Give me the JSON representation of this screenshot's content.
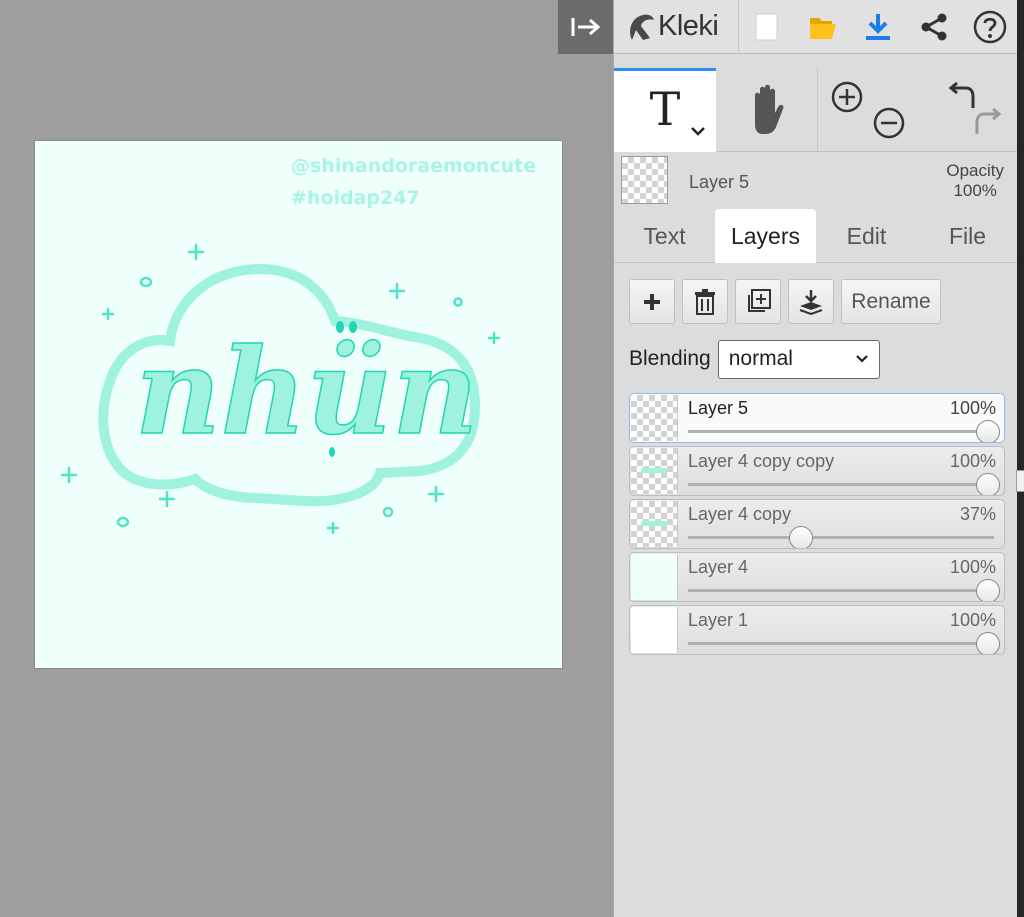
{
  "app": {
    "name": "Kleki",
    "accent": "#2b8ef5"
  },
  "toolbar": {
    "icons": [
      "kleki-logo-icon",
      "new-image-icon",
      "open-folder-icon",
      "download-icon",
      "share-icon",
      "help-icon"
    ]
  },
  "tools": {
    "active": "text",
    "text_glyph": "T",
    "icons": [
      "text-tool-icon",
      "hand-tool-icon",
      "zoom-in-icon",
      "zoom-out-icon",
      "undo-icon",
      "redo-icon"
    ]
  },
  "current_layer": {
    "name": "Layer 5",
    "opacity_label": "Opacity",
    "opacity_value": "100%"
  },
  "tabs": [
    {
      "label": "Text",
      "active": false
    },
    {
      "label": "Layers",
      "active": true
    },
    {
      "label": "Edit",
      "active": false
    },
    {
      "label": "File",
      "active": false
    }
  ],
  "layer_actions": {
    "rename_label": "Rename",
    "icons": [
      "add-layer-icon",
      "delete-layer-icon",
      "duplicate-layer-icon",
      "merge-down-icon"
    ]
  },
  "blending": {
    "label": "Blending",
    "value": "normal"
  },
  "layers": [
    {
      "name": "Layer 5",
      "opacity": "100%",
      "opacity_value": 100,
      "active": true
    },
    {
      "name": "Layer 4 copy copy",
      "opacity": "100%",
      "opacity_value": 100,
      "active": false
    },
    {
      "name": "Layer 4 copy",
      "opacity": "37%",
      "opacity_value": 37,
      "active": false
    },
    {
      "name": "Layer 4",
      "opacity": "100%",
      "opacity_value": 100,
      "active": false
    },
    {
      "name": "Layer 1",
      "opacity": "100%",
      "opacity_value": 100,
      "active": false
    }
  ],
  "canvas": {
    "watermark_line1": "@shinandoraemoncute",
    "watermark_line2": "#hoidap247",
    "artwork_text": "nhün",
    "colors": {
      "background": "#effffc",
      "mint": "#9ff3de",
      "dark_mint": "#21d6b3"
    }
  }
}
